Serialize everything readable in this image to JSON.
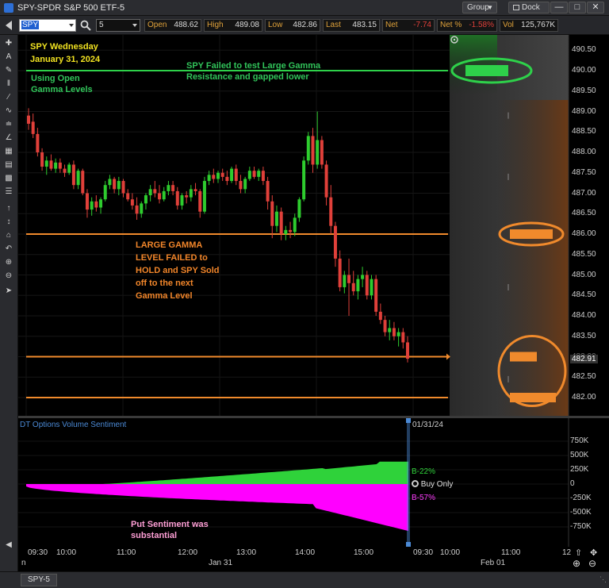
{
  "window": {
    "title": "SPY-SPDR S&P 500 ETF-5",
    "group_label": "Group",
    "dock_label": "Dock",
    "minimize_glyph": "—",
    "maximize_glyph": "□",
    "close_glyph": "✕"
  },
  "quote": {
    "symbol": "SPY",
    "interval": "5",
    "open_label": "Open",
    "open_value": "488.62",
    "high_label": "High",
    "high_value": "489.08",
    "low_label": "Low",
    "low_value": "482.86",
    "last_label": "Last",
    "last_value": "483.15",
    "net_label": "Net",
    "net_value": "-7.74",
    "netpct_label": "Net %",
    "netpct_value": "-1.58%",
    "vol_label": "Vol",
    "vol_value": "125,767K"
  },
  "colors": {
    "up": "#2ecc2e",
    "down": "#e0403a",
    "gamma_green": "#2ed14a",
    "gamma_orange": "#f08a2c",
    "call_fill": "#2fd23a",
    "put_fill": "#ff00ff",
    "pane_title": "#4b8ad6"
  },
  "annotations": {
    "date_line1": "SPY Wednesday",
    "date_line2": "January 31, 2024",
    "open_gamma_line1": "Using Open",
    "open_gamma_line2": "Gamma Levels",
    "failed_test_line1": "SPY Failed to test Large Gamma",
    "failed_test_line2": "Resistance and gapped lower",
    "large_gamma_lines": [
      "LARGE GAMMA",
      "LEVEL FAILED to",
      "HOLD and SPY Sold",
      "off to the next",
      "Gamma Level"
    ],
    "put_sentiment_line1": "Put Sentiment was",
    "put_sentiment_line2": "substantial"
  },
  "price_axis": {
    "labels": [
      "490.50",
      "490.00",
      "489.50",
      "489.00",
      "488.50",
      "488.00",
      "487.50",
      "487.00",
      "486.50",
      "486.00",
      "485.50",
      "485.00",
      "484.50",
      "484.00",
      "483.50",
      "483.00",
      "482.50",
      "482.00"
    ],
    "last_marker": "482.91"
  },
  "sentiment_pane": {
    "title": "DT Options Volume Sentiment",
    "date_label": "01/31/24",
    "call_label": "B-22%",
    "put_label": "B-57%",
    "buy_only_label": "Buy Only",
    "axis_labels": [
      "750K",
      "500K",
      "250K",
      "0",
      "-250K",
      "-500K",
      "-750K"
    ]
  },
  "time_axis": {
    "labels": [
      "09:30",
      "10:00",
      "11:00",
      "12:00",
      "13:00",
      "14:00",
      "15:00",
      "09:30",
      "10:00",
      "11:00",
      "12"
    ],
    "date_labels": [
      "Jan 31",
      "Feb 01"
    ],
    "corner_label": "n"
  },
  "tabs": [
    {
      "label": "SPY-5"
    }
  ],
  "chart_data": {
    "type": "candlestick",
    "symbol": "SPY",
    "interval_minutes": 5,
    "ylim": [
      481.8,
      490.7
    ],
    "gamma_levels": [
      490.0,
      486.0,
      483.0,
      482.0
    ],
    "candles": [
      {
        "o": 488.9,
        "h": 489.08,
        "l": 488.55,
        "c": 488.7
      },
      {
        "o": 488.75,
        "h": 488.95,
        "l": 488.35,
        "c": 488.45
      },
      {
        "o": 488.45,
        "h": 488.6,
        "l": 487.9,
        "c": 488.0
      },
      {
        "o": 488.0,
        "h": 488.1,
        "l": 487.55,
        "c": 487.65
      },
      {
        "o": 487.65,
        "h": 487.9,
        "l": 487.45,
        "c": 487.8
      },
      {
        "o": 487.8,
        "h": 487.95,
        "l": 487.55,
        "c": 487.6
      },
      {
        "o": 487.6,
        "h": 487.85,
        "l": 487.5,
        "c": 487.75
      },
      {
        "o": 487.75,
        "h": 487.85,
        "l": 487.5,
        "c": 487.6
      },
      {
        "o": 487.6,
        "h": 487.7,
        "l": 487.4,
        "c": 487.5
      },
      {
        "o": 487.5,
        "h": 487.75,
        "l": 487.45,
        "c": 487.7
      },
      {
        "o": 487.7,
        "h": 487.8,
        "l": 487.1,
        "c": 487.2
      },
      {
        "o": 487.2,
        "h": 487.6,
        "l": 487.1,
        "c": 487.55
      },
      {
        "o": 487.55,
        "h": 487.6,
        "l": 486.95,
        "c": 487.0
      },
      {
        "o": 487.0,
        "h": 487.1,
        "l": 486.4,
        "c": 486.6
      },
      {
        "o": 486.6,
        "h": 486.9,
        "l": 486.45,
        "c": 486.8
      },
      {
        "o": 486.8,
        "h": 486.95,
        "l": 486.55,
        "c": 486.65
      },
      {
        "o": 486.65,
        "h": 486.9,
        "l": 486.5,
        "c": 486.85
      },
      {
        "o": 486.85,
        "h": 487.3,
        "l": 486.8,
        "c": 487.2
      },
      {
        "o": 487.2,
        "h": 487.45,
        "l": 487.1,
        "c": 487.35
      },
      {
        "o": 487.35,
        "h": 487.4,
        "l": 487.0,
        "c": 487.1
      },
      {
        "o": 487.1,
        "h": 487.4,
        "l": 486.95,
        "c": 487.3
      },
      {
        "o": 487.3,
        "h": 487.35,
        "l": 486.9,
        "c": 487.0
      },
      {
        "o": 487.0,
        "h": 487.1,
        "l": 486.8,
        "c": 486.85
      },
      {
        "o": 486.85,
        "h": 487.0,
        "l": 486.6,
        "c": 486.7
      },
      {
        "o": 486.7,
        "h": 486.9,
        "l": 486.35,
        "c": 486.5
      },
      {
        "o": 486.5,
        "h": 486.8,
        "l": 486.4,
        "c": 486.75
      },
      {
        "o": 486.75,
        "h": 487.0,
        "l": 486.6,
        "c": 486.95
      },
      {
        "o": 486.95,
        "h": 487.2,
        "l": 486.8,
        "c": 487.1
      },
      {
        "o": 487.1,
        "h": 487.3,
        "l": 486.9,
        "c": 487.0
      },
      {
        "o": 487.0,
        "h": 487.2,
        "l": 486.75,
        "c": 486.85
      },
      {
        "o": 486.85,
        "h": 487.15,
        "l": 486.8,
        "c": 487.05
      },
      {
        "o": 487.05,
        "h": 487.3,
        "l": 486.95,
        "c": 487.2
      },
      {
        "o": 487.2,
        "h": 487.3,
        "l": 486.95,
        "c": 487.05
      },
      {
        "o": 487.05,
        "h": 487.15,
        "l": 486.6,
        "c": 486.7
      },
      {
        "o": 486.7,
        "h": 487.0,
        "l": 486.6,
        "c": 486.95
      },
      {
        "o": 486.95,
        "h": 487.05,
        "l": 486.75,
        "c": 486.9
      },
      {
        "o": 486.9,
        "h": 487.2,
        "l": 486.8,
        "c": 487.1
      },
      {
        "o": 487.1,
        "h": 487.25,
        "l": 486.95,
        "c": 487.05
      },
      {
        "o": 487.05,
        "h": 487.1,
        "l": 486.4,
        "c": 486.55
      },
      {
        "o": 486.55,
        "h": 487.4,
        "l": 486.5,
        "c": 487.3
      },
      {
        "o": 487.3,
        "h": 487.55,
        "l": 487.2,
        "c": 487.45
      },
      {
        "o": 487.45,
        "h": 487.6,
        "l": 487.25,
        "c": 487.35
      },
      {
        "o": 487.35,
        "h": 487.55,
        "l": 487.25,
        "c": 487.5
      },
      {
        "o": 487.5,
        "h": 487.6,
        "l": 487.3,
        "c": 487.4
      },
      {
        "o": 487.4,
        "h": 487.55,
        "l": 487.2,
        "c": 487.3
      },
      {
        "o": 487.3,
        "h": 487.65,
        "l": 487.25,
        "c": 487.6
      },
      {
        "o": 487.6,
        "h": 487.7,
        "l": 487.2,
        "c": 487.3
      },
      {
        "o": 487.3,
        "h": 487.45,
        "l": 487.0,
        "c": 487.1
      },
      {
        "o": 487.1,
        "h": 487.4,
        "l": 487.0,
        "c": 487.35
      },
      {
        "o": 487.35,
        "h": 487.65,
        "l": 487.3,
        "c": 487.55
      },
      {
        "o": 487.55,
        "h": 487.65,
        "l": 487.35,
        "c": 487.4
      },
      {
        "o": 487.4,
        "h": 487.6,
        "l": 487.3,
        "c": 487.55
      },
      {
        "o": 487.55,
        "h": 487.65,
        "l": 487.2,
        "c": 487.3
      },
      {
        "o": 487.3,
        "h": 487.4,
        "l": 486.6,
        "c": 486.8
      },
      {
        "o": 486.8,
        "h": 486.95,
        "l": 485.9,
        "c": 486.2
      },
      {
        "o": 486.2,
        "h": 486.7,
        "l": 486.05,
        "c": 486.55
      },
      {
        "o": 486.55,
        "h": 486.65,
        "l": 485.85,
        "c": 486.0
      },
      {
        "o": 486.0,
        "h": 486.2,
        "l": 485.85,
        "c": 486.1
      },
      {
        "o": 486.1,
        "h": 486.3,
        "l": 485.9,
        "c": 486.05
      },
      {
        "o": 486.05,
        "h": 486.5,
        "l": 485.95,
        "c": 486.4
      },
      {
        "o": 486.4,
        "h": 486.9,
        "l": 486.3,
        "c": 486.85
      },
      {
        "o": 486.85,
        "h": 487.9,
        "l": 486.8,
        "c": 487.8
      },
      {
        "o": 487.8,
        "h": 488.5,
        "l": 487.7,
        "c": 488.4
      },
      {
        "o": 488.4,
        "h": 488.6,
        "l": 487.5,
        "c": 487.7
      },
      {
        "o": 487.7,
        "h": 489.0,
        "l": 487.6,
        "c": 488.3
      },
      {
        "o": 488.3,
        "h": 488.4,
        "l": 487.6,
        "c": 487.7
      },
      {
        "o": 487.7,
        "h": 487.8,
        "l": 486.7,
        "c": 486.9
      },
      {
        "o": 486.9,
        "h": 487.2,
        "l": 486.0,
        "c": 486.2
      },
      {
        "o": 486.2,
        "h": 486.3,
        "l": 485.2,
        "c": 485.4
      },
      {
        "o": 485.4,
        "h": 485.6,
        "l": 484.6,
        "c": 484.7
      },
      {
        "o": 484.7,
        "h": 485.1,
        "l": 484.55,
        "c": 485.0
      },
      {
        "o": 485.0,
        "h": 485.4,
        "l": 484.0,
        "c": 484.8
      },
      {
        "o": 484.8,
        "h": 485.1,
        "l": 484.5,
        "c": 484.6
      },
      {
        "o": 484.6,
        "h": 485.0,
        "l": 484.4,
        "c": 484.9
      },
      {
        "o": 484.9,
        "h": 485.2,
        "l": 484.7,
        "c": 485.0
      },
      {
        "o": 485.0,
        "h": 485.1,
        "l": 484.4,
        "c": 484.5
      },
      {
        "o": 484.5,
        "h": 485.0,
        "l": 484.4,
        "c": 484.9
      },
      {
        "o": 484.9,
        "h": 485.0,
        "l": 484.0,
        "c": 484.1
      },
      {
        "o": 484.1,
        "h": 484.3,
        "l": 483.8,
        "c": 483.9
      },
      {
        "o": 483.9,
        "h": 484.0,
        "l": 483.5,
        "c": 483.6
      },
      {
        "o": 483.6,
        "h": 483.9,
        "l": 483.4,
        "c": 483.7
      },
      {
        "o": 483.7,
        "h": 483.85,
        "l": 483.4,
        "c": 483.5
      },
      {
        "o": 483.5,
        "h": 483.7,
        "l": 483.25,
        "c": 483.6
      },
      {
        "o": 483.6,
        "h": 483.7,
        "l": 483.2,
        "c": 483.35
      },
      {
        "o": 483.35,
        "h": 483.5,
        "l": 482.86,
        "c": 482.95
      }
    ],
    "sentiment_call_max": 400000,
    "sentiment_put_min": -820000
  }
}
